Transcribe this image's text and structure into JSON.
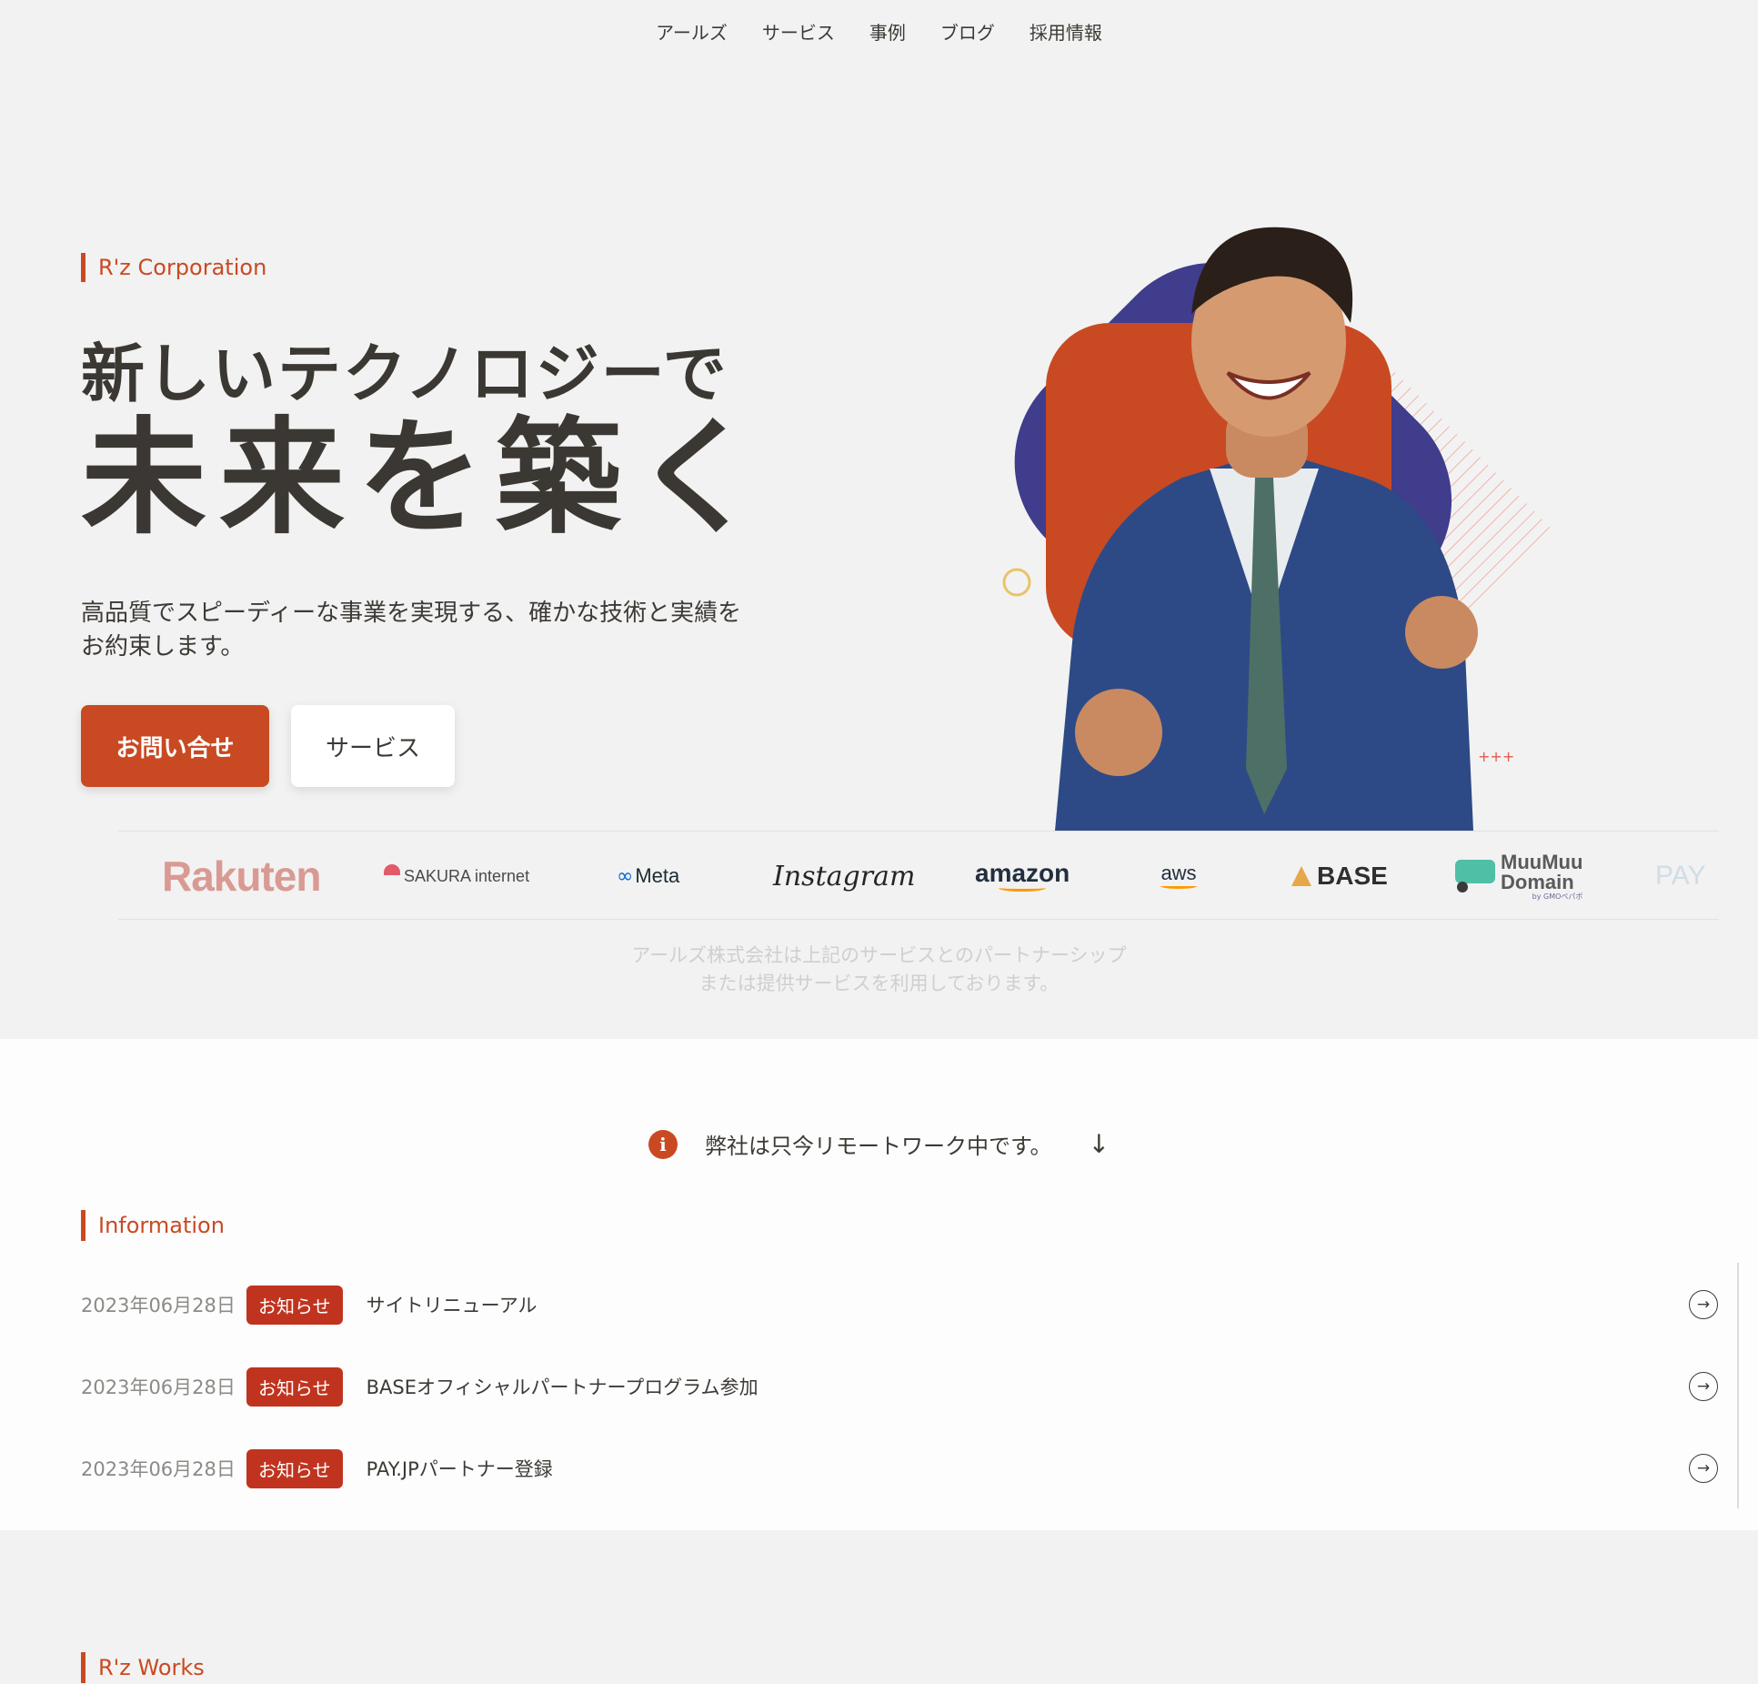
{
  "nav": {
    "items": [
      "アールズ",
      "サービス",
      "事例",
      "ブログ",
      "採用情報"
    ]
  },
  "hero": {
    "eyebrow": "R'z Corporation",
    "headline_line1": "新しいテクノロジーで",
    "headline_line2": "未来を築く",
    "lead": "高品質でスピーディーな事業を実現する、確かな技術と実績をお約束します。",
    "primary_button": "お問い合せ",
    "secondary_button": "サービス",
    "art": {
      "accent": "#c94a22",
      "navy": "#3f3d8c",
      "pink": "#f1b3aa"
    }
  },
  "partners": {
    "logos": [
      {
        "name": "Rakuten",
        "icon": "rakuten-logo",
        "color": "#d99a93"
      },
      {
        "name": "SAKURA internet",
        "icon": "sakura-internet-logo",
        "color": "#4a4a4a"
      },
      {
        "name": "Meta",
        "icon": "meta-logo",
        "color": "#1c2b33"
      },
      {
        "name": "Instagram",
        "icon": "instagram-logo",
        "color": "#262626"
      },
      {
        "name": "amazon",
        "icon": "amazon-logo",
        "color": "#232f3e"
      },
      {
        "name": "aws",
        "icon": "aws-logo",
        "color": "#232f3e"
      },
      {
        "name": "BASE",
        "icon": "base-logo",
        "color": "#2f2f2f"
      },
      {
        "name_line1": "MuuMuu",
        "name_line2": "Domain",
        "tagline": "by GMOペパボ",
        "icon": "muumuu-domain-logo",
        "color": "#5a5a5a"
      },
      {
        "name": "PAY",
        "icon": "pay-jp-logo",
        "color": "#cfdde8"
      }
    ],
    "note_line1": "アールズ株式会社は上記のサービスとのパートナーシップ",
    "note_line2": "または提供サービスを利用しております。"
  },
  "notice": {
    "icon": "info-icon",
    "text": "弊社は只今リモートワーク中です。",
    "arrow_icon": "arrow-down-icon"
  },
  "information": {
    "label": "Information",
    "rows": [
      {
        "date": "2023年06月28日",
        "tag": "お知らせ",
        "title": "サイトリニューアル"
      },
      {
        "date": "2023年06月28日",
        "tag": "お知らせ",
        "title": "BASEオフィシャルパートナープログラム参加"
      },
      {
        "date": "2023年06月28日",
        "tag": "お知らせ",
        "title": "PAY.JPパートナー登録"
      }
    ]
  },
  "works": {
    "label": "R'z Works"
  }
}
